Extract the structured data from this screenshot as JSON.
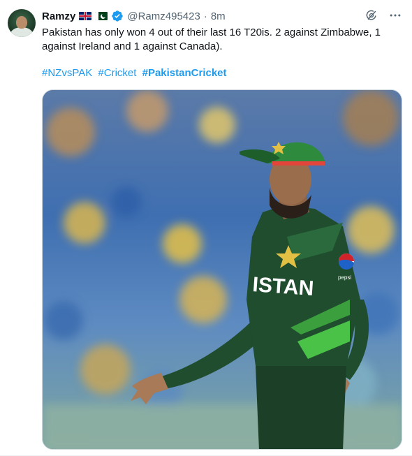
{
  "author": {
    "name": "Ramzy",
    "handle": "@Ramz495423",
    "separator": "·",
    "time": "8m"
  },
  "tweet": {
    "text": "Pakistan has only won 4 out of their last 16 T20is. 2 against Zimbabwe, 1 against Ireland and 1 against Canada).",
    "hashtags": [
      "#NZvsPAK",
      "#Cricket",
      "#PakistanCricket"
    ]
  },
  "media": {
    "jersey_text": "ISTAN",
    "sponsor_text": "pepsi"
  },
  "icons": {
    "flag_1": "uk-flag-icon",
    "flag_2": "pakistan-flag-icon",
    "verified": "verified-badge-icon",
    "grok": "grok-icon",
    "more": "more-icon"
  },
  "colors": {
    "link": "#1d9bf0",
    "muted": "#536471",
    "jersey": "#1f4d2e",
    "jersey_light": "#4fcf4a"
  }
}
